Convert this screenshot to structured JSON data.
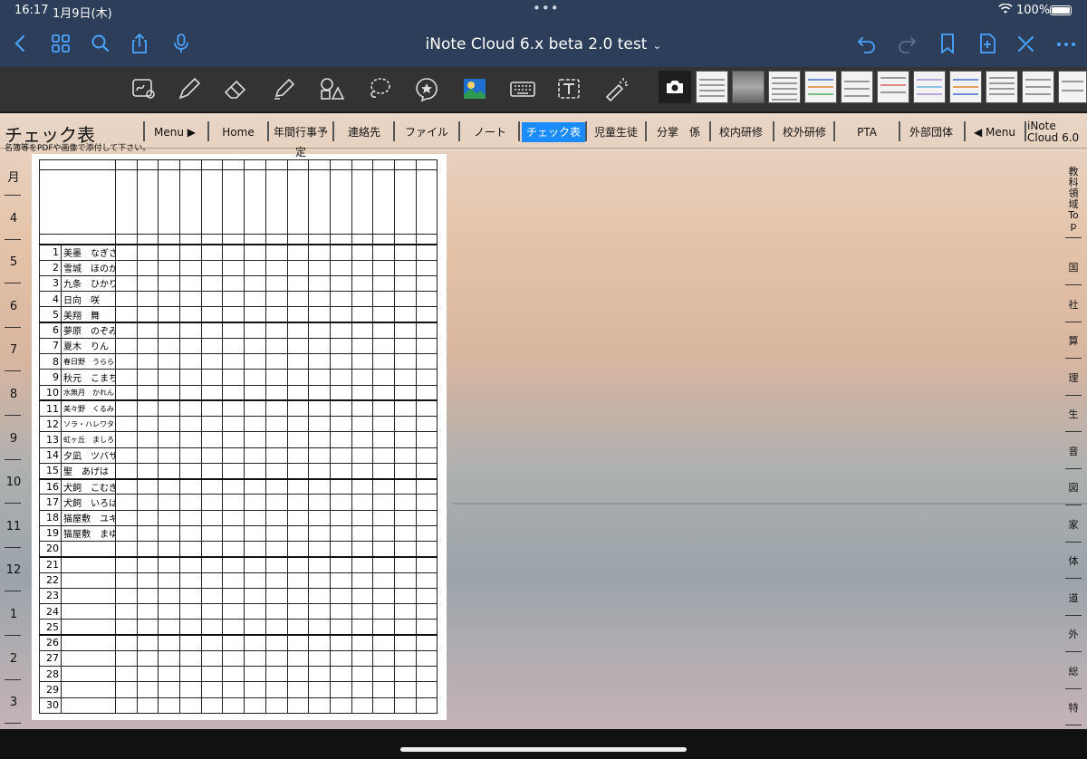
{
  "status": {
    "time": "16:17",
    "date": "1月9日(木)",
    "dots": "•••",
    "battery": "100%"
  },
  "nav": {
    "title": "iNote Cloud 6.x beta 2.0 test"
  },
  "header": {
    "title": "チェック表",
    "subtitle": "名簿等をPDFや画像で添付して下さい。",
    "menu": [
      "Menu ▶",
      "Home",
      "年間行事予定",
      "連絡先",
      "ファイル",
      "ノート",
      "チェック表",
      "児童生徒",
      "分掌　係",
      "校内研修",
      "校外研修",
      "PTA",
      "外部団体",
      "◀ Menu"
    ],
    "active_menu": "チェック表",
    "brand_line1": "iNote",
    "brand_line2": "Cloud 6.0"
  },
  "months": [
    "月",
    "4",
    "5",
    "6",
    "7",
    "8",
    "9",
    "10",
    "11",
    "12",
    "1",
    "2",
    "3"
  ],
  "subjects": [
    "教科領域Top",
    "国",
    "社",
    "算",
    "理",
    "生",
    "音",
    "図",
    "家",
    "体",
    "道",
    "外",
    "総",
    "特"
  ],
  "students": [
    {
      "no": "1",
      "name": "美墨　なぎさ"
    },
    {
      "no": "2",
      "name": "雪城　ほのか"
    },
    {
      "no": "3",
      "name": "九条　ひかり"
    },
    {
      "no": "4",
      "name": "日向　咲"
    },
    {
      "no": "5",
      "name": "美翔　舞"
    },
    {
      "no": "6",
      "name": "夢原　のぞみ"
    },
    {
      "no": "7",
      "name": "夏木　りん"
    },
    {
      "no": "8",
      "name": "春日野　うらら"
    },
    {
      "no": "9",
      "name": "秋元　こまち"
    },
    {
      "no": "10",
      "name": "水無月　かれん"
    },
    {
      "no": "11",
      "name": "美々野　くるみ"
    },
    {
      "no": "12",
      "name": "ソラ・ハレワタール"
    },
    {
      "no": "13",
      "name": "虹ヶ丘　ましろ"
    },
    {
      "no": "14",
      "name": "夕凪　ツバサ"
    },
    {
      "no": "15",
      "name": "聖　あげは"
    },
    {
      "no": "16",
      "name": "犬飼　こむぎ"
    },
    {
      "no": "17",
      "name": "犬飼　いろは"
    },
    {
      "no": "18",
      "name": "猫屋敷　ユキ"
    },
    {
      "no": "19",
      "name": "猫屋敷　まゆ"
    },
    {
      "no": "20",
      "name": ""
    },
    {
      "no": "21",
      "name": ""
    },
    {
      "no": "22",
      "name": ""
    },
    {
      "no": "23",
      "name": ""
    },
    {
      "no": "24",
      "name": ""
    },
    {
      "no": "25",
      "name": ""
    },
    {
      "no": "26",
      "name": ""
    },
    {
      "no": "27",
      "name": ""
    },
    {
      "no": "28",
      "name": ""
    },
    {
      "no": "29",
      "name": ""
    },
    {
      "no": "30",
      "name": ""
    }
  ],
  "check_columns": 15,
  "toolbar_tools": [
    "handwriting-zoom",
    "pen",
    "eraser",
    "highlighter",
    "shapes",
    "lasso",
    "sticker",
    "image",
    "keyboard",
    "text-box",
    "laser-pointer",
    "camera"
  ]
}
